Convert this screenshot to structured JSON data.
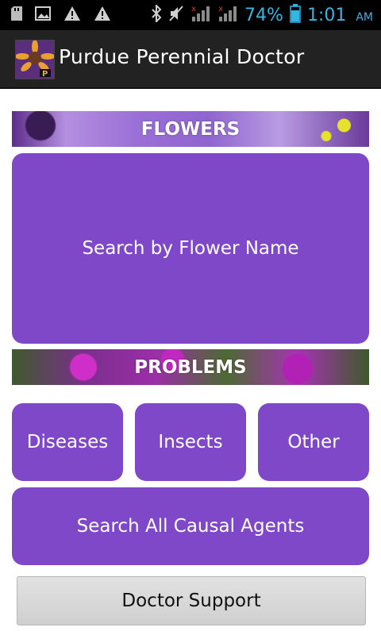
{
  "status_bar": {
    "battery": "74%",
    "time": "1:01",
    "ampm": "AM",
    "icons": [
      "sd-card-icon",
      "image-icon",
      "warning-icon",
      "warning-icon",
      "bluetooth-icon",
      "mute-icon",
      "signal-icon",
      "signal-icon",
      "battery-icon"
    ]
  },
  "app": {
    "title": "Purdue Perennial Doctor"
  },
  "flowers": {
    "banner_label": "FLOWERS",
    "search_button": "Search by Flower Name"
  },
  "problems": {
    "banner_label": "PROBLEMS",
    "diseases": "Diseases",
    "insects": "Insects",
    "other": "Other",
    "causal_agents": "Search All Causal Agents"
  },
  "footer": {
    "doctor_support": "Doctor Support"
  },
  "colors": {
    "accent": "#7f48c9",
    "status_text": "#33b5e5",
    "action_bar": "#222222"
  }
}
